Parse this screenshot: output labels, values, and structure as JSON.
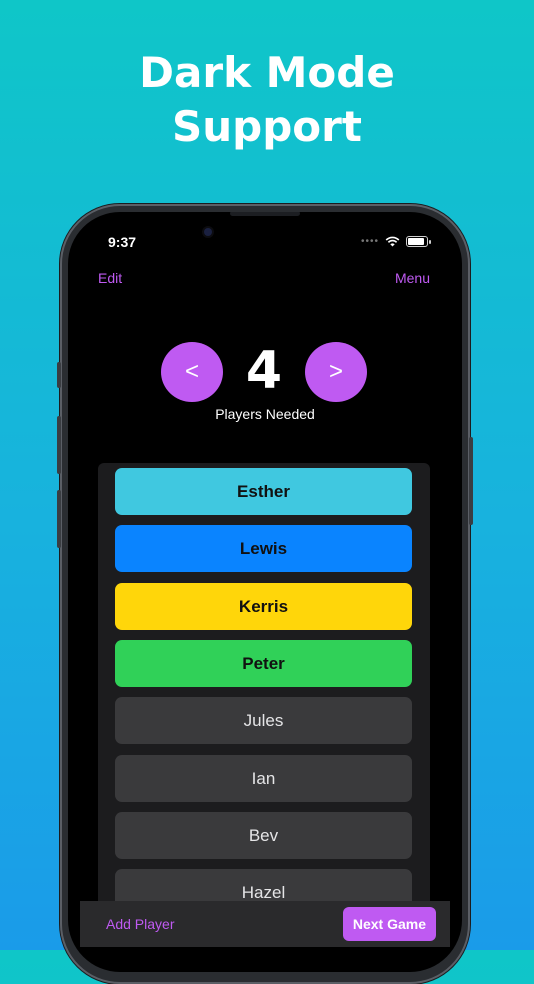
{
  "headline": {
    "line1": "Dark Mode",
    "line2": "Support"
  },
  "status_bar": {
    "time": "9:37",
    "signal_icon": "signal-dots-icon",
    "wifi_icon": "wifi-icon",
    "battery_icon": "battery-icon"
  },
  "nav": {
    "edit_label": "Edit",
    "menu_label": "Menu"
  },
  "stepper": {
    "decrement_label": "<",
    "increment_label": ">",
    "count": "4",
    "caption": "Players Needed"
  },
  "players": [
    {
      "name": "Esther",
      "color": "#40c8e0",
      "selected": true
    },
    {
      "name": "Lewis",
      "color": "#0a84ff",
      "selected": true
    },
    {
      "name": "Kerris",
      "color": "#ffd60a",
      "selected": true
    },
    {
      "name": "Peter",
      "color": "#30d158",
      "selected": true
    },
    {
      "name": "Jules",
      "color": "#3a3a3c",
      "selected": false
    },
    {
      "name": "Ian",
      "color": "#3a3a3c",
      "selected": false
    },
    {
      "name": "Bev",
      "color": "#3a3a3c",
      "selected": false
    },
    {
      "name": "Hazel",
      "color": "#3a3a3c",
      "selected": false
    }
  ],
  "bottom_bar": {
    "add_player_label": "Add Player",
    "next_game_label": "Next Game"
  },
  "colors": {
    "accent": "#bf5af2",
    "background_top": "#0fc6c8",
    "background_bottom": "#1a9be9"
  }
}
